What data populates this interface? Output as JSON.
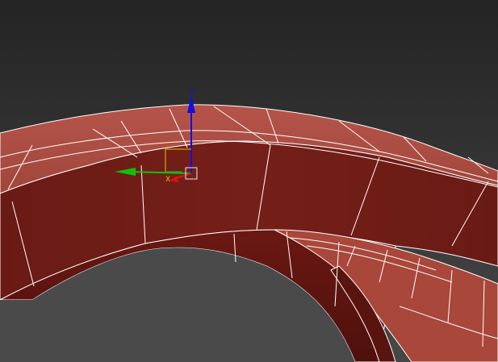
{
  "viewport": {
    "background_top": "#242424",
    "background_bottom": "#474747"
  },
  "model": {
    "top_face_color": "#a8473a",
    "inner_side_color": "#6e1a15",
    "outer_side_color": "#7a211b",
    "shadow_side_color": "#5a1410",
    "wire_color": "#ffffff"
  },
  "gizmo": {
    "z_label": "Z",
    "x_label": "X",
    "z_color": "#1010e0",
    "y_color": "#10c010",
    "x_color": "#e01010",
    "plane_color": "#f0c000",
    "center_icon": "transform-center-box-icon"
  }
}
